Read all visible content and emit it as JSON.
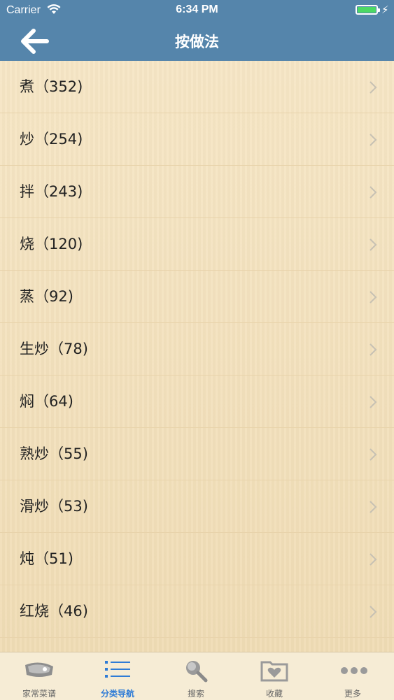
{
  "status_bar": {
    "carrier": "Carrier",
    "time": "6:34 PM"
  },
  "nav": {
    "title": "按做法"
  },
  "list": {
    "items": [
      {
        "label": "煮（352)"
      },
      {
        "label": "炒（254)"
      },
      {
        "label": "拌（243)"
      },
      {
        "label": "烧（120)"
      },
      {
        "label": "蒸（92)"
      },
      {
        "label": "生炒（78)"
      },
      {
        "label": "焖（64)"
      },
      {
        "label": "熟炒（55)"
      },
      {
        "label": "滑炒（53)"
      },
      {
        "label": "炖（51)"
      },
      {
        "label": "红烧（46)"
      }
    ]
  },
  "tabs": [
    {
      "label": "家常菜谱",
      "icon": "meat-icon",
      "active": false
    },
    {
      "label": "分类导航",
      "icon": "list-icon",
      "active": true
    },
    {
      "label": "搜索",
      "icon": "search-icon",
      "active": false
    },
    {
      "label": "收藏",
      "icon": "heart-folder-icon",
      "active": false
    },
    {
      "label": "更多",
      "icon": "more-icon",
      "active": false
    }
  ],
  "colors": {
    "header": "#5585ab",
    "active_tab": "#2f7cd6",
    "battery": "#4cd964"
  }
}
